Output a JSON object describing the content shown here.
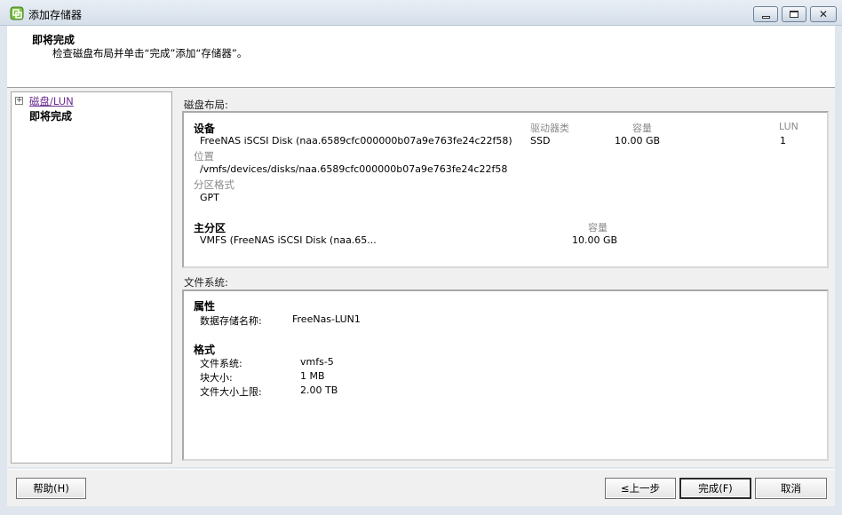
{
  "window": {
    "title": "添加存储器"
  },
  "header": {
    "title": "即将完成",
    "subtitle": "检查磁盘布局并单击“完成”添加“存储器”。"
  },
  "nav": {
    "items": [
      {
        "label": "磁盘/LUN",
        "expander": "+"
      },
      {
        "label": "即将完成"
      }
    ]
  },
  "disk_layout": {
    "section_label": "磁盘布局:",
    "device_header": "设备",
    "driver_type_header": "驱动器类",
    "capacity_header": "容量",
    "lun_header": "LUN",
    "device_name": "FreeNAS iSCSI Disk (naa.6589cfc000000b07a9e763fe24c22f58)",
    "driver_type": "SSD",
    "capacity": "10.00 GB",
    "lun": "1",
    "location_label": "位置",
    "location_value": "/vmfs/devices/disks/naa.6589cfc000000b07a9e763fe24c22f58",
    "partition_format_label": "分区格式",
    "partition_format_value": "GPT",
    "primary_partition_header": "主分区",
    "partition_capacity_header": "容量",
    "partition_name": "VMFS (FreeNAS iSCSI Disk (naa.65...",
    "partition_capacity": "10.00 GB"
  },
  "file_system": {
    "section_label": "文件系统:",
    "properties_header": "属性",
    "datastore_name_label": "数据存储名称:",
    "datastore_name_value": "FreeNas-LUN1",
    "format_header": "格式",
    "fs_label": "文件系统:",
    "fs_value": "vmfs-5",
    "block_size_label": "块大小:",
    "block_size_value": "1 MB",
    "max_file_size_label": "文件大小上限:",
    "max_file_size_value": "2.00 TB"
  },
  "footer": {
    "help": "帮助(H)",
    "back": "≤上一步",
    "finish": "完成(F)",
    "cancel": "取消"
  }
}
